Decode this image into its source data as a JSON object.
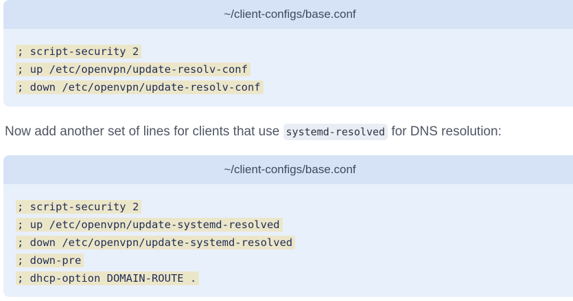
{
  "blocks": [
    {
      "filename": "~/client-configs/base.conf",
      "lines": [
        "; script-security 2",
        "; up /etc/openvpn/update-resolv-conf",
        "; down /etc/openvpn/update-resolv-conf"
      ]
    },
    {
      "filename": "~/client-configs/base.conf",
      "lines": [
        "; script-security 2",
        "; up /etc/openvpn/update-systemd-resolved",
        "; down /etc/openvpn/update-systemd-resolved",
        "; down-pre",
        "; dhcp-option DOMAIN-ROUTE ."
      ]
    }
  ],
  "prose": {
    "before": "Now add another set of lines for clients that use ",
    "code": "systemd-resolved",
    "after": " for DNS resolution:"
  }
}
